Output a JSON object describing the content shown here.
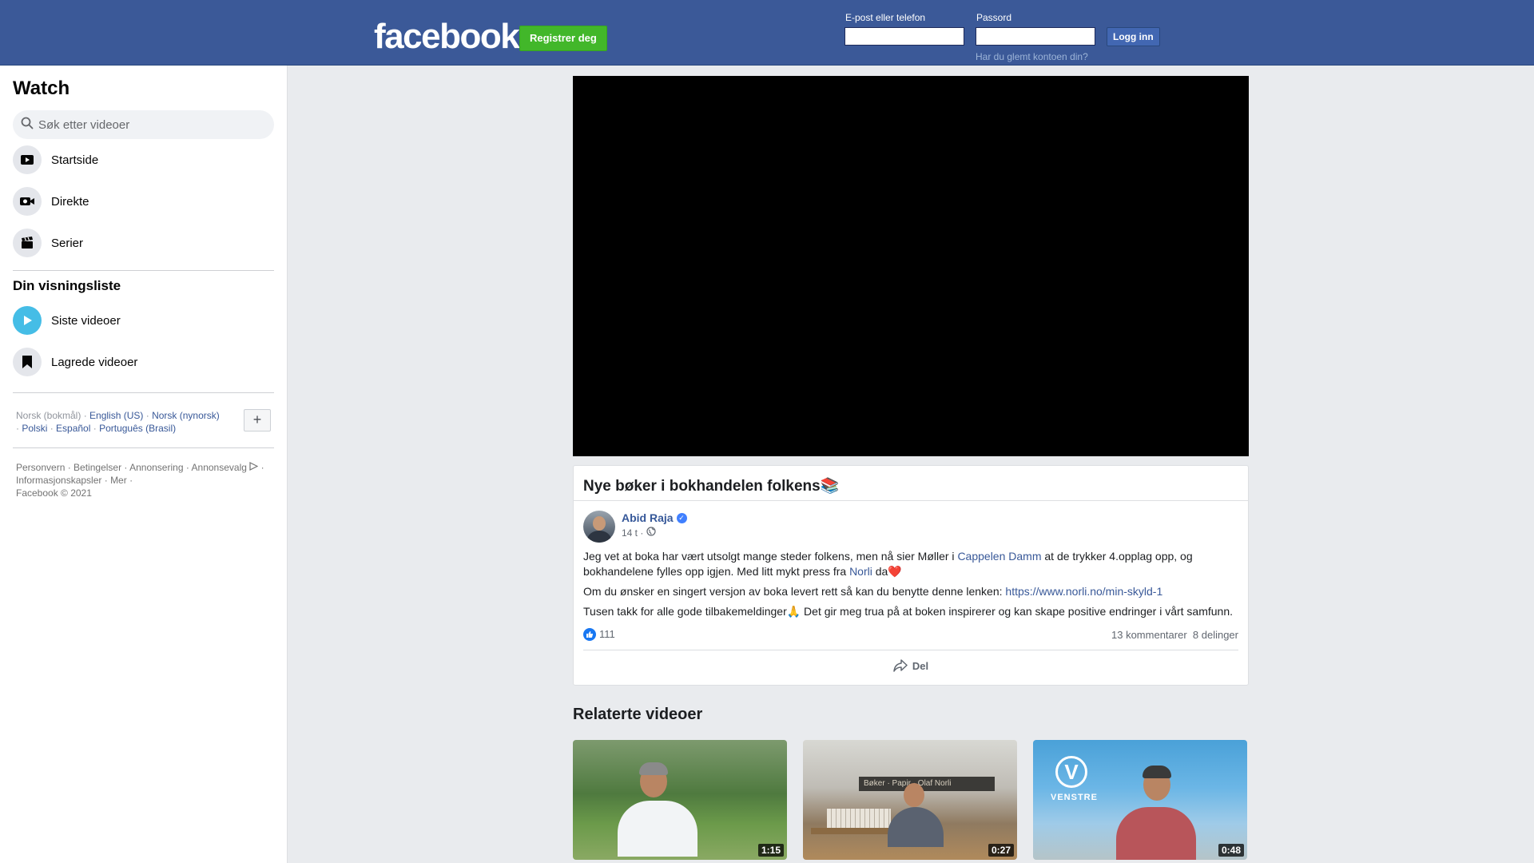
{
  "header": {
    "logo": "facebook",
    "register_label": "Registrer deg",
    "email_label": "E-post eller telefon",
    "password_label": "Passord",
    "login_label": "Logg inn",
    "forgot_label": "Har du glemt kontoen din?",
    "email_value": "",
    "password_value": ""
  },
  "sidebar": {
    "title": "Watch",
    "search_placeholder": "Søk etter videoer",
    "nav": [
      {
        "label": "Startside",
        "icon": "play-video-icon"
      },
      {
        "label": "Direkte",
        "icon": "live-camera-icon"
      },
      {
        "label": "Serier",
        "icon": "clapperboard-icon"
      }
    ],
    "watchlist_title": "Din visningsliste",
    "watchlist": [
      {
        "label": "Siste videoer",
        "icon": "play-circle-icon"
      },
      {
        "label": "Lagrede videoer",
        "icon": "bookmark-icon"
      }
    ],
    "languages": {
      "current": "Norsk (bokmål)",
      "links": [
        "English (US)",
        "Norsk (nynorsk)",
        "Polski",
        "Español",
        "Português (Brasil)"
      ],
      "add_label": "+"
    },
    "footer": {
      "links": [
        "Personvern",
        "Betingelser",
        "Annonsering",
        "Annonsevalg",
        "Informasjonskapsler",
        "Mer"
      ],
      "copyright": "Facebook © 2021"
    }
  },
  "post": {
    "title": "Nye bøker i bokhandelen folkens📚",
    "author": "Abid Raja",
    "time": "14 t",
    "p1_a": "Jeg vet at boka har vært utsolgt mange steder folkens, men nå sier Møller i ",
    "p1_link1": "Cappelen Damm",
    "p1_b": " at de trykker 4.opplag opp, og bokhandelene fylles opp igjen. Med litt mykt press fra ",
    "p1_link2": "Norli",
    "p1_c": " da❤️",
    "p2_a": "Om du ønsker en singert versjon av boka levert rett så kan du benytte denne lenken: ",
    "p2_link": "https://www.norli.no/min-skyld-1",
    "p3": "Tusen takk for alle gode tilbakemeldinger🙏 Det gir meg trua på at boken inspirerer og kan skape positive endringer i vårt samfunn.",
    "likes": "111",
    "comments": "13 kommentarer",
    "shares": "8 delinger",
    "share_label": "Del"
  },
  "related": {
    "title": "Relaterte videoer",
    "videos": [
      {
        "duration": "1:15"
      },
      {
        "duration": "0:27"
      },
      {
        "duration": "0:48"
      }
    ],
    "thumb3_logo": "V",
    "thumb3_text": "VENSTRE",
    "thumb2_sign": "Bøker · Papir · Olaf Norli"
  },
  "colors": {
    "header_bg": "#3b5998",
    "register_bg": "#42b72a",
    "link": "#385898",
    "like_blue": "#1877f2"
  }
}
